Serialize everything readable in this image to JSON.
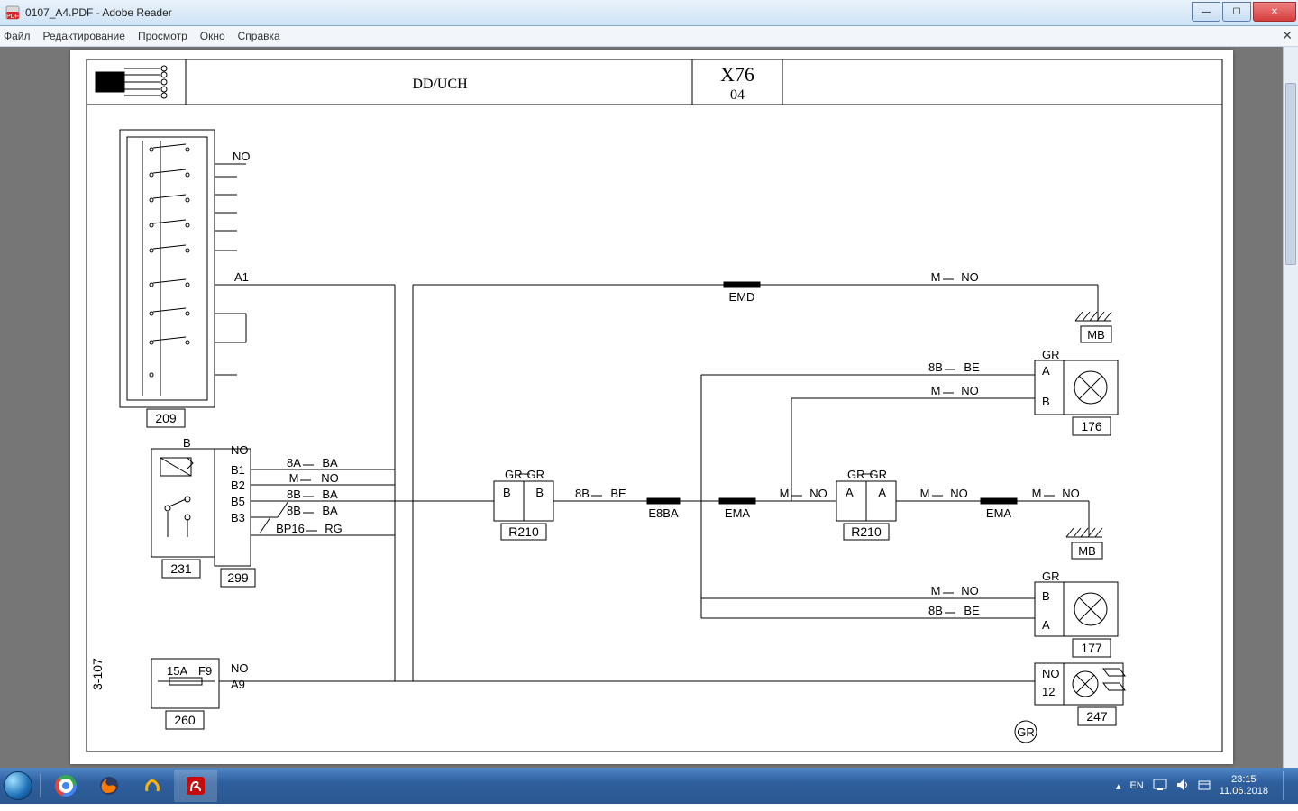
{
  "window": {
    "title": "0107_A4.PDF - Adobe Reader"
  },
  "menu": {
    "file": "Файл",
    "edit": "Редактирование",
    "view": "Просмотр",
    "window": "Окно",
    "help": "Справка"
  },
  "header": {
    "center": "DD/UCH",
    "model": "X76",
    "model_sub": "04"
  },
  "blocks": {
    "b209": "209",
    "b231": "231",
    "b299": "299",
    "b260": "260",
    "b176": "176",
    "b177": "177",
    "b247": "247",
    "r210a": "R210",
    "r210b": "R210",
    "mb1": "MB",
    "mb2": "MB"
  },
  "labels": {
    "NO": "NO",
    "A1": "A1",
    "B": "B",
    "B1": "B1",
    "B2": "B2",
    "B3": "B3",
    "B5": "B5",
    "BP16_RG": "BP16",
    "RG": "RG",
    "8A_BA": "8A",
    "BA": "BA",
    "8B": "8B",
    "BE": "BE",
    "M": "M",
    "GR": "GR",
    "A": "A",
    "fuse": "15A",
    "fuse_slot": "F9",
    "A9": "A9",
    "twelve": "12",
    "EMD": "EMD",
    "E8BA": "E8BA",
    "EMA": "EMA"
  },
  "pagenum": "3-107",
  "tray": {
    "lang": "EN",
    "time": "23:15",
    "date": "11.06.2018"
  }
}
